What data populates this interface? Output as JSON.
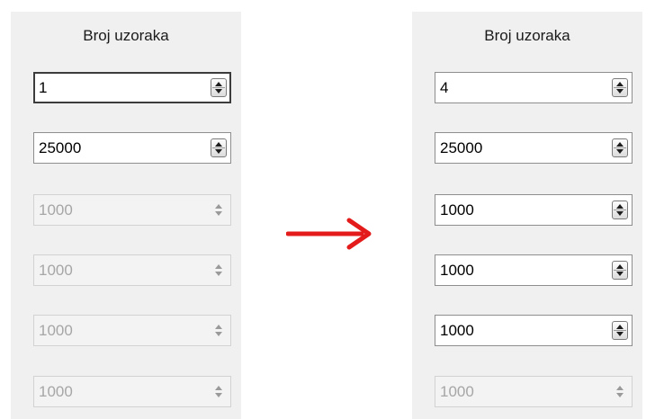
{
  "left_panel": {
    "title": "Broj uzoraka",
    "fields": [
      {
        "value": "1",
        "state": "focused"
      },
      {
        "value": "25000",
        "state": "enabled"
      },
      {
        "value": "1000",
        "state": "disabled"
      },
      {
        "value": "1000",
        "state": "disabled"
      },
      {
        "value": "1000",
        "state": "disabled"
      },
      {
        "value": "1000",
        "state": "disabled"
      }
    ]
  },
  "right_panel": {
    "title": "Broj uzoraka",
    "fields": [
      {
        "value": "4",
        "state": "enabled"
      },
      {
        "value": "25000",
        "state": "enabled"
      },
      {
        "value": "1000",
        "state": "enabled"
      },
      {
        "value": "1000",
        "state": "enabled"
      },
      {
        "value": "1000",
        "state": "enabled"
      },
      {
        "value": "1000",
        "state": "disabled"
      }
    ]
  },
  "transition_arrow": {
    "icon": "right-arrow-icon",
    "color": "#e31b1b"
  }
}
